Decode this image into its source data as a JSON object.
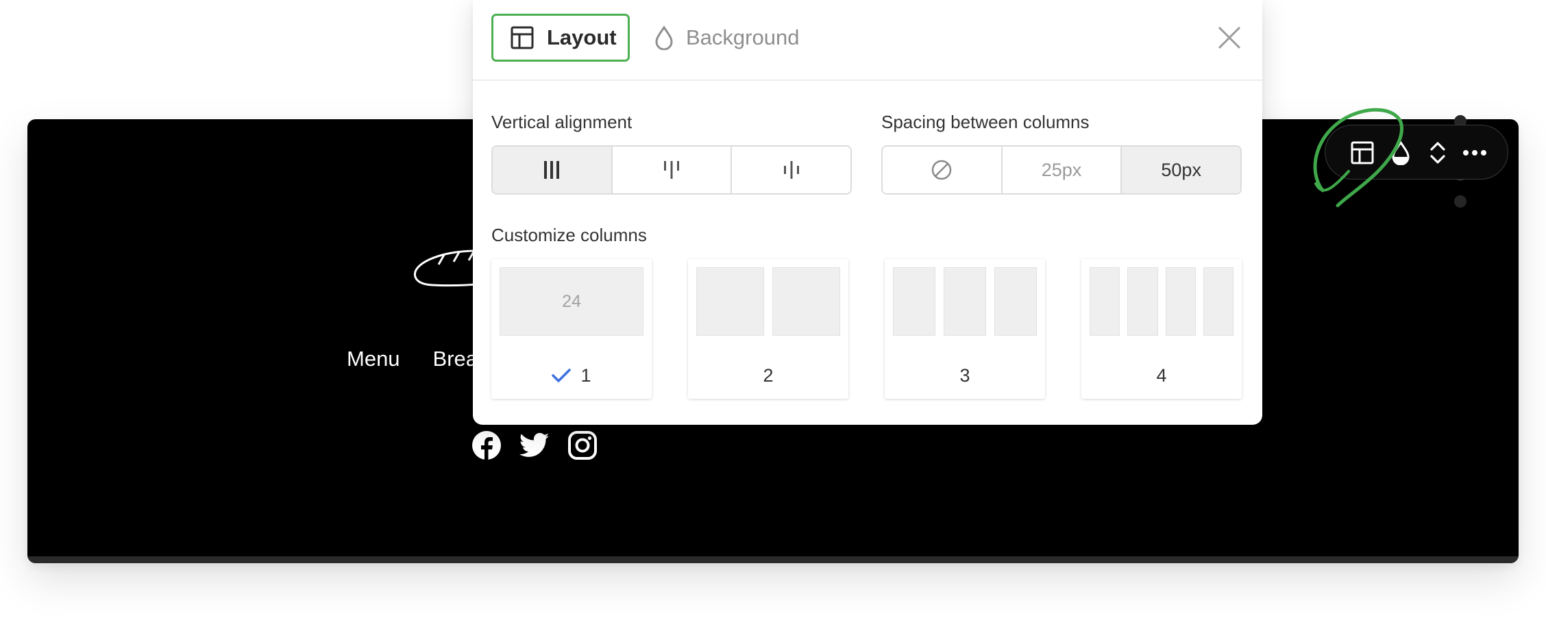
{
  "panel": {
    "tabs": [
      {
        "label": "Layout",
        "icon": "layout-icon",
        "active": true
      },
      {
        "label": "Background",
        "icon": "droplet-icon",
        "active": false
      }
    ],
    "vertical_alignment": {
      "label": "Vertical alignment",
      "options": [
        "stretch",
        "top",
        "center"
      ],
      "selected": "stretch"
    },
    "spacing": {
      "label": "Spacing between columns",
      "options": [
        "",
        "25px",
        "50px"
      ],
      "selected": "50px"
    },
    "customize_columns": {
      "label": "Customize columns",
      "options": [
        {
          "count": "1",
          "preview_text": "24",
          "selected": true
        },
        {
          "count": "2",
          "selected": false
        },
        {
          "count": "3",
          "selected": false
        },
        {
          "count": "4",
          "selected": false
        }
      ]
    }
  },
  "site": {
    "nav": [
      "Menu",
      "Brea"
    ],
    "social": [
      "facebook-icon",
      "twitter-icon",
      "instagram-icon"
    ]
  },
  "toolbar": {
    "icons": [
      "layout-icon",
      "droplet-icon",
      "move-up-down-icon",
      "more-icon"
    ]
  },
  "colors": {
    "accent_green": "#4caf50",
    "check_blue": "#3d6fe0",
    "section_bg": "#000000"
  }
}
